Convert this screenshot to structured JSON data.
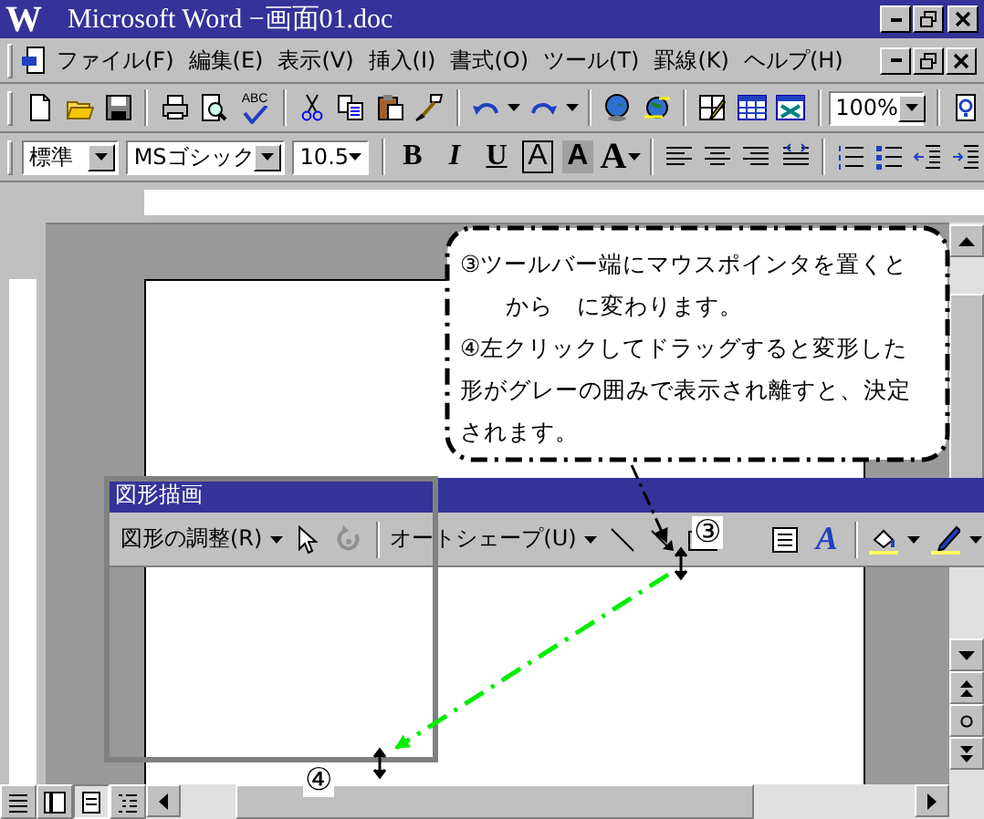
{
  "window": {
    "logo": "W",
    "title": "Microsoft Word −画面01.doc"
  },
  "menu": [
    "ファイル(F)",
    "編集(E)",
    "表示(V)",
    "挿入(I)",
    "書式(O)",
    "ツール(T)",
    "罫線(K)",
    "ヘルプ(H)"
  ],
  "standard_toolbar": {
    "spellcheck": "ABC",
    "zoom": "100%"
  },
  "formatting_toolbar": {
    "style": "標準",
    "font": "MSゴシック",
    "size": "10.5",
    "buttons": [
      {
        "label": "B",
        "kind": "bold"
      },
      {
        "label": "I",
        "kind": "italic"
      },
      {
        "label": "U",
        "kind": "underline"
      },
      {
        "label": "A",
        "kind": "boxed"
      },
      {
        "label": "A",
        "kind": "shaded"
      },
      {
        "label": "A",
        "kind": "spacing"
      }
    ]
  },
  "drawing_toolbar": {
    "title": "図形描画",
    "draw_menu": "図形の調整(R)",
    "autoshapes": "オートシェープ(U)",
    "wordart": "A"
  },
  "callout": {
    "lines": [
      "③ツールバー端にマウスポインタを置くと",
      "から　に変わります。",
      "④左クリックしてドラッグすると変形した",
      "形がグレーの囲みで表示され離すと、決定",
      "されます。"
    ]
  },
  "markers": [
    "③",
    "④"
  ]
}
